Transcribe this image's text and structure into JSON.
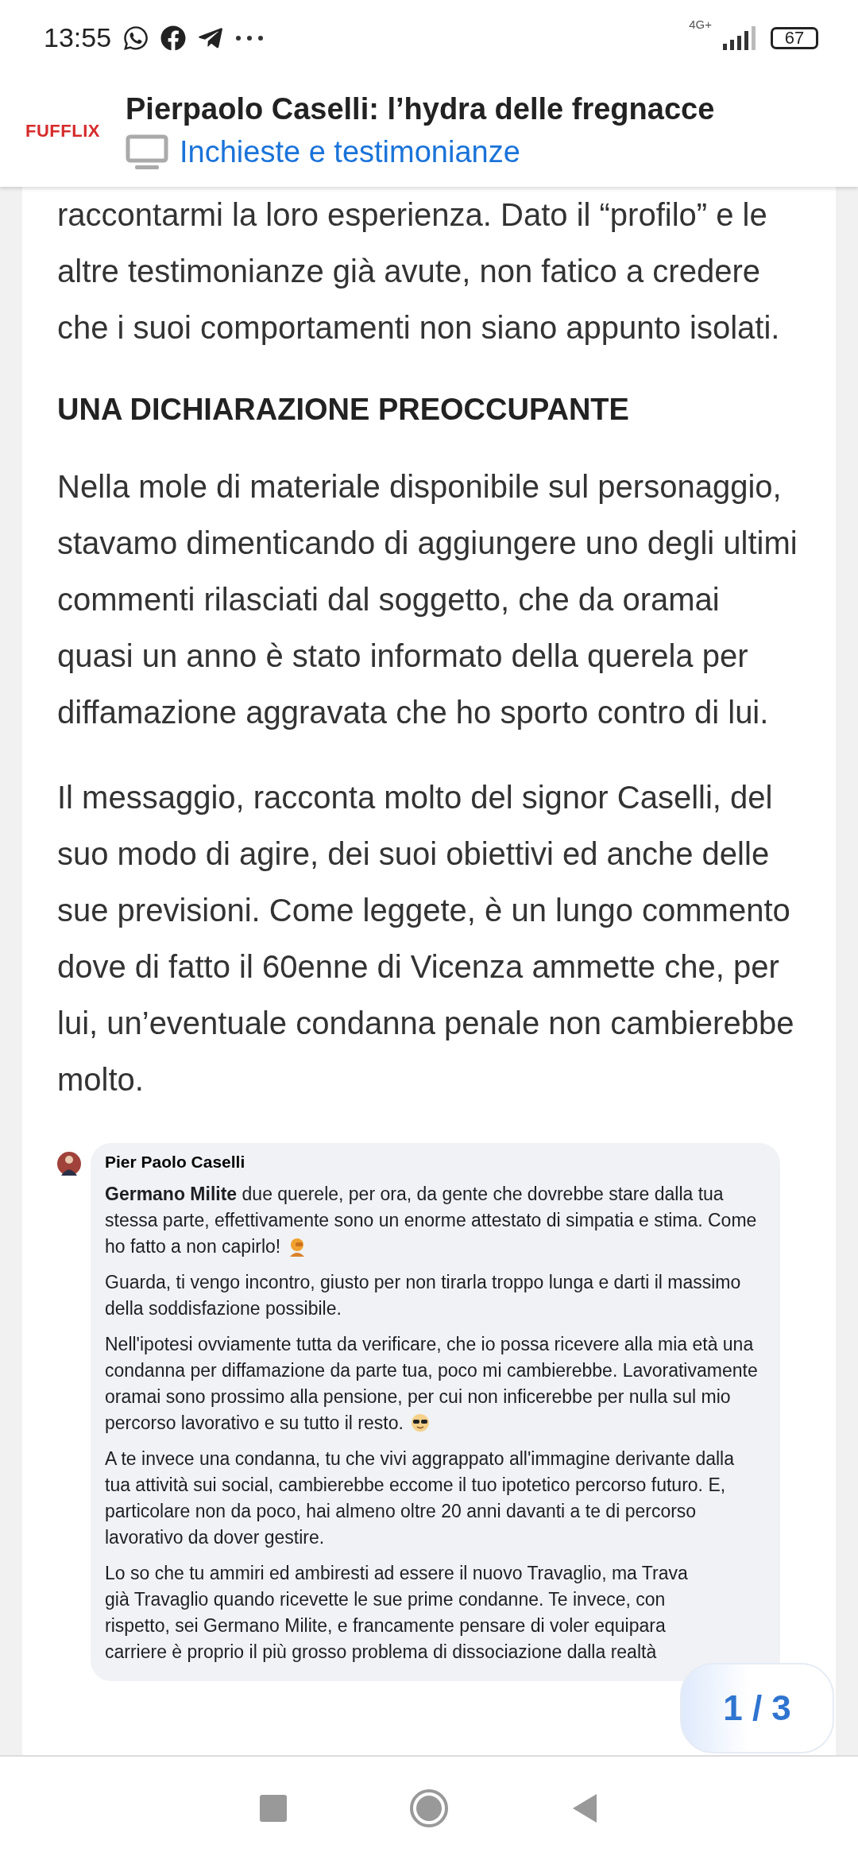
{
  "status_bar": {
    "time": "13:55",
    "network": "4G+",
    "battery": "67"
  },
  "header": {
    "logo": "FUFFLIX",
    "title": "Pierpaolo Caselli: l’hydra delle fregnacce",
    "category": "Inchieste e testimonianze"
  },
  "article": [
    {
      "kind": "paragraph",
      "text": "raccontarmi la loro esperienza. Dato il “profilo” e le altre testimonianze già avute, non fatico a credere che i suoi comportamenti non siano appunto isolati."
    },
    {
      "kind": "heading",
      "text": "UNA DICHIARAZIONE PREOCCUPANTE"
    },
    {
      "kind": "paragraph",
      "text": "Nella mole di materiale disponibile sul personaggio, stavamo dimenticando di aggiungere uno degli ultimi commenti rilasciati dal soggetto, che da oramai quasi un anno è stato informato della querela per diffamazione aggravata che ho sporto contro di lui."
    },
    {
      "kind": "paragraph",
      "text": "Il messaggio, racconta molto del signor Caselli, del suo modo di agire, dei suoi obiettivi ed anche delle sue previsioni. Come leggete, è un lungo commento dove di fatto il 60enne di Vicenza ammette che, per lui, un’eventuale condanna penale non cambierebbe molto."
    }
  ],
  "comment": {
    "author": "Pier Paolo Caselli",
    "paragraphs": [
      {
        "kind": "text",
        "text": "**Germano Milite** due querele, per ora, da gente che dovrebbe stare dalla tua stessa parte, effettivamente sono un enorme attestato di simpatia e stima. Come ho fatto a non capirlo!"
      },
      {
        "kind": "text",
        "text": "Guarda, ti vengo incontro, giusto per non tirarla troppo lunga e darti il massimo della soddisfazione possibile."
      },
      {
        "kind": "text",
        "text": "Nell'ipotesi ovviamente tutta da verificare, che io possa ricevere alla mia età una condanna per diffamazione da parte tua, poco mi cambierebbe. Lavorativamente oramai sono prossimo alla pensione, per cui non inficerebbe per nulla sul mio percorso lavorativo e su tutto il resto."
      },
      {
        "kind": "text",
        "text": "A te invece una condanna, tu che vivi aggrappato all'immagine derivante dalla tua attività sui social, cambierebbe eccome il tuo ipotetico percorso futuro. E, particolare non da poco, hai almeno oltre 20 anni davanti a te di percorso lavorativo da dover gestire."
      },
      {
        "kind": "cut",
        "lines": [
          "Lo so che tu ammiri ed ambiresti ad essere il nuovo Travaglio, ma Trava",
          "già Travaglio quando ricevette le sue prime condanne. Te invece, con",
          "rispetto, sei Germano Milite, e francamente pensare di voler equipara",
          "carriere è proprio il più grosso problema di dissociazione dalla realtà"
        ]
      }
    ]
  },
  "pager": {
    "label": "1 / 3"
  }
}
